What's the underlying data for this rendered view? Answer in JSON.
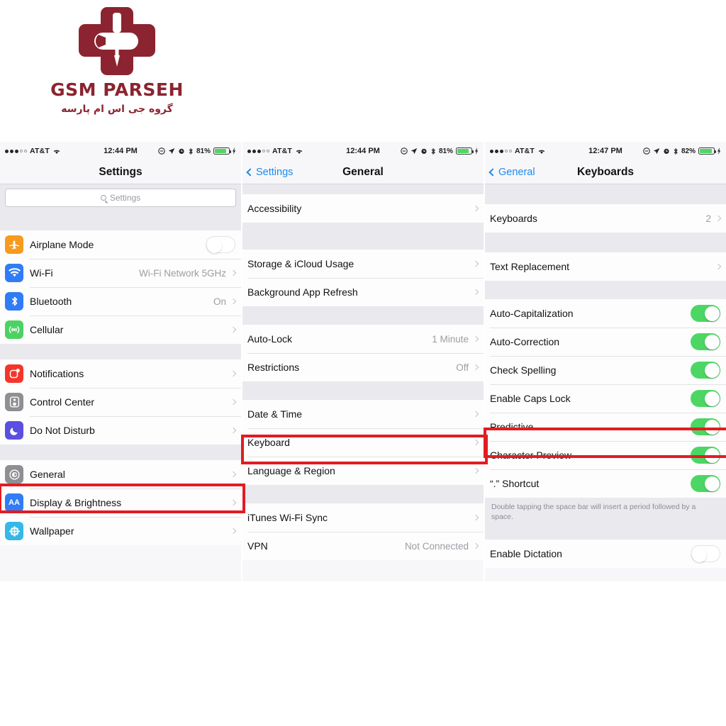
{
  "brand": {
    "color": "#8b2430",
    "name": "GSM PARSEH",
    "subtitle": "گروه جی اس ام پارسه",
    "logo_icon": "medical-cross-wrench-screwdriver-icon"
  },
  "panels": [
    {
      "id": "settings",
      "statusbar": {
        "carrier": "AT&T",
        "time": "12:44 PM",
        "battery_percent": "81%",
        "icons": [
          "signal-dots-icon",
          "wifi-icon",
          "do-not-disturb-icon",
          "location-arrow-icon",
          "alarm-clock-icon",
          "bluetooth-icon",
          "battery-icon",
          "charging-bolt-icon"
        ]
      },
      "nav": {
        "title": "Settings",
        "back": null
      },
      "search": {
        "placeholder": "Settings",
        "icon": "search-icon"
      },
      "groups": [
        {
          "rows": [
            {
              "label": "Airplane Mode",
              "icon": "airplane-icon",
              "icon_color": "#f79a1e",
              "control": "toggle",
              "toggle_on": false
            },
            {
              "label": "Wi-Fi",
              "icon": "wifi-icon",
              "icon_color": "#2f7cf6",
              "value": "Wi-Fi Network 5GHz",
              "control": "chevron"
            },
            {
              "label": "Bluetooth",
              "icon": "bluetooth-icon",
              "icon_color": "#2f7cf6",
              "value": "On",
              "control": "chevron"
            },
            {
              "label": "Cellular",
              "icon": "cellular-icon",
              "icon_color": "#4cd263",
              "value": "",
              "control": "chevron"
            }
          ]
        },
        {
          "rows": [
            {
              "label": "Notifications",
              "icon": "notifications-icon",
              "icon_color": "#f5352b",
              "value": "",
              "control": "chevron"
            },
            {
              "label": "Control Center",
              "icon": "control-center-icon",
              "icon_color": "#8e8e93",
              "value": "",
              "control": "chevron"
            },
            {
              "label": "Do Not Disturb",
              "icon": "moon-icon",
              "icon_color": "#5a4fe0",
              "value": "",
              "control": "chevron"
            }
          ]
        },
        {
          "highlight_index": 0,
          "rows": [
            {
              "label": "General",
              "icon": "gear-icon",
              "icon_color": "#8e8e93",
              "value": "",
              "control": "chevron",
              "highlighted": true
            },
            {
              "label": "Display & Brightness",
              "icon": "display-aa-icon",
              "icon_color": "#2f7cf6",
              "value": "",
              "control": "chevron"
            },
            {
              "label": "Wallpaper",
              "icon": "wallpaper-flower-icon",
              "icon_color": "#35b8e8",
              "value": "",
              "control": "chevron"
            }
          ]
        }
      ]
    },
    {
      "id": "general",
      "statusbar": {
        "carrier": "AT&T",
        "time": "12:44 PM",
        "battery_percent": "81%"
      },
      "nav": {
        "title": "General",
        "back": "Settings"
      },
      "groups": [
        {
          "rows": [
            {
              "label": "Accessibility",
              "value": "",
              "control": "chevron"
            }
          ]
        },
        {
          "rows": [
            {
              "label": "Storage & iCloud Usage",
              "value": "",
              "control": "chevron"
            },
            {
              "label": "Background App Refresh",
              "value": "",
              "control": "chevron"
            }
          ]
        },
        {
          "rows": [
            {
              "label": "Auto-Lock",
              "value": "1 Minute",
              "control": "chevron"
            },
            {
              "label": "Restrictions",
              "value": "Off",
              "control": "chevron"
            }
          ]
        },
        {
          "rows": [
            {
              "label": "Date & Time",
              "value": "",
              "control": "chevron"
            },
            {
              "label": "Keyboard",
              "value": "",
              "control": "chevron",
              "highlighted": true
            },
            {
              "label": "Language & Region",
              "value": "",
              "control": "chevron"
            }
          ]
        },
        {
          "rows": [
            {
              "label": "iTunes Wi-Fi Sync",
              "value": "",
              "control": "chevron"
            },
            {
              "label": "VPN",
              "value": "Not Connected",
              "control": "chevron"
            }
          ]
        }
      ]
    },
    {
      "id": "keyboards",
      "statusbar": {
        "carrier": "AT&T",
        "time": "12:47 PM",
        "battery_percent": "82%"
      },
      "nav": {
        "title": "Keyboards",
        "back": "General"
      },
      "groups": [
        {
          "rows": [
            {
              "label": "Keyboards",
              "value": "2",
              "control": "chevron"
            }
          ]
        },
        {
          "rows": [
            {
              "label": "Text Replacement",
              "value": "",
              "control": "chevron"
            }
          ]
        },
        {
          "rows": [
            {
              "label": "Auto-Capitalization",
              "control": "toggle",
              "toggle_on": true
            },
            {
              "label": "Auto-Correction",
              "control": "toggle",
              "toggle_on": true
            },
            {
              "label": "Check Spelling",
              "control": "toggle",
              "toggle_on": true
            },
            {
              "label": "Enable Caps Lock",
              "control": "toggle",
              "toggle_on": true
            },
            {
              "label": "Predictive",
              "control": "toggle",
              "toggle_on": true,
              "highlighted": true
            },
            {
              "label": "Character Preview",
              "control": "toggle",
              "toggle_on": true
            },
            {
              "label": "“.” Shortcut",
              "control": "toggle",
              "toggle_on": true
            }
          ]
        },
        {
          "footnote": "Double tapping the space bar will insert a period followed by a space."
        },
        {
          "rows": [
            {
              "label": "Enable Dictation",
              "control": "toggle",
              "toggle_on": false
            }
          ]
        }
      ]
    }
  ],
  "highlight_color": "#e21c21"
}
